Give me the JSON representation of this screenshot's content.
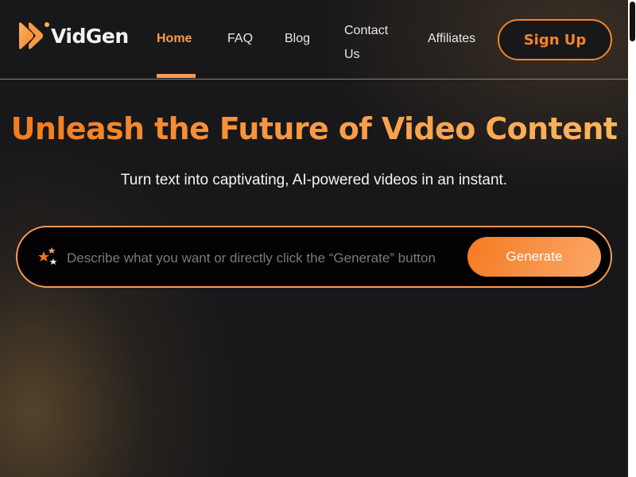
{
  "brand": {
    "name": "VidGen",
    "accent": "#f4832a"
  },
  "nav": {
    "items": [
      {
        "label": "Home",
        "active": true
      },
      {
        "label": "FAQ",
        "active": false
      },
      {
        "label": "Blog",
        "active": false
      },
      {
        "label": "Contact Us",
        "active": false
      },
      {
        "label": "Affiliates",
        "active": false
      }
    ],
    "contact_line1": "Contact",
    "contact_line2": "Us",
    "signup_label": "Sign Up"
  },
  "hero": {
    "headline": "Unleash the Future of Video Content",
    "subtitle": "Turn text into captivating, AI-powered videos in an instant."
  },
  "prompt": {
    "placeholder": "Describe what you want or directly click the “Generate” button",
    "value": "",
    "generate_label": "Generate",
    "icon": "sparkle-stars-icon"
  }
}
